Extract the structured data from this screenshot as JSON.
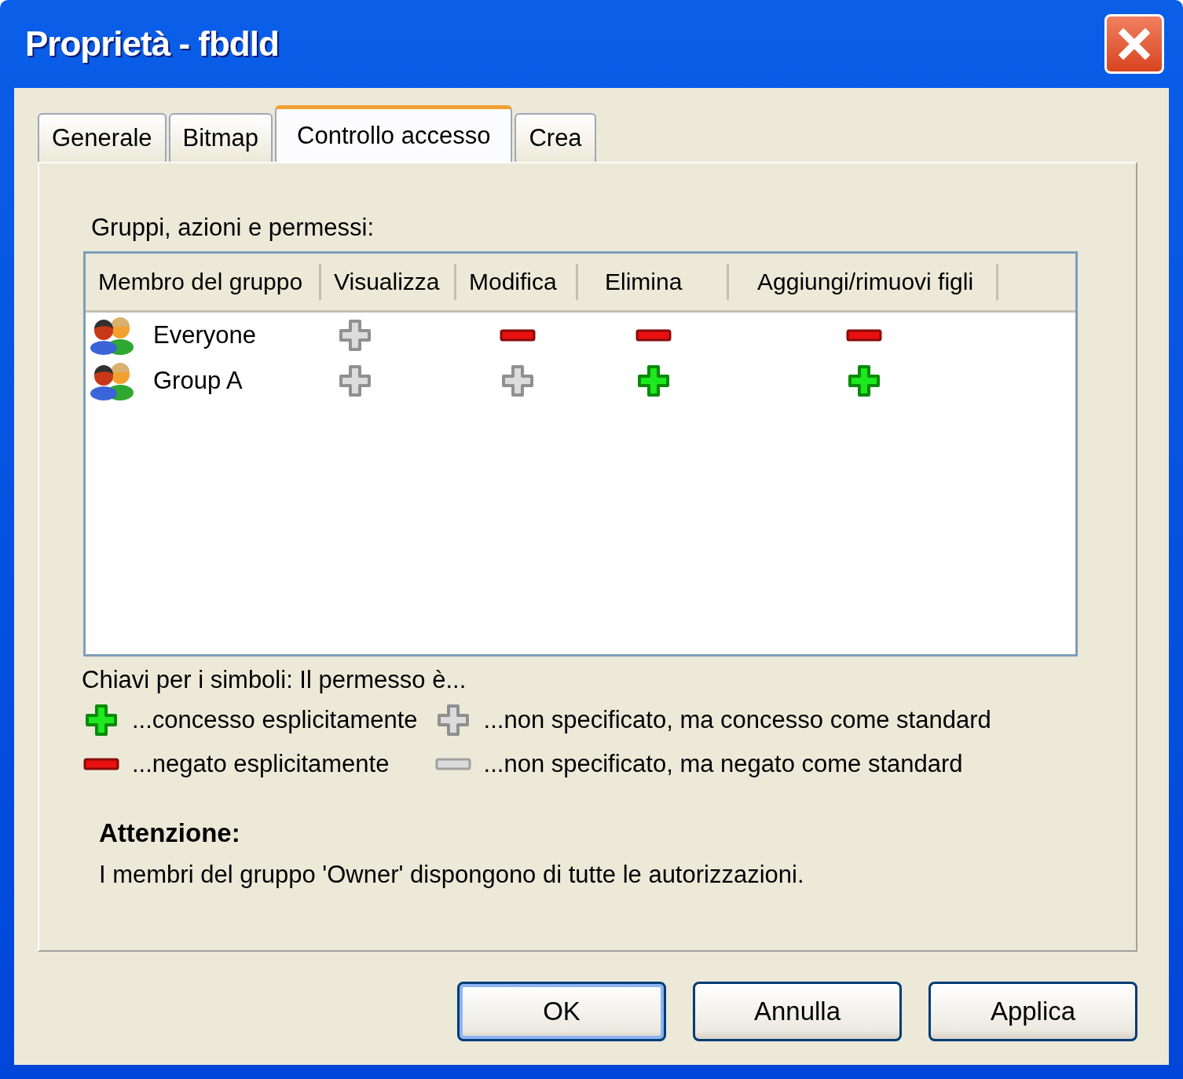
{
  "window": {
    "title": "Proprietà - fbdld"
  },
  "tabs": [
    {
      "label": "Generale",
      "selected": false
    },
    {
      "label": "Bitmap",
      "selected": false
    },
    {
      "label": "Controllo accesso",
      "selected": true
    },
    {
      "label": "Crea",
      "selected": false
    }
  ],
  "table": {
    "caption": "Gruppi, azioni e permessi:",
    "columns": [
      "Membro del gruppo",
      "Visualizza",
      "Modifica",
      "Elimina",
      "Aggiungi/rimuovi figli"
    ],
    "rows": [
      {
        "member": "Everyone",
        "cells": [
          {
            "kind": "default_allow"
          },
          {
            "kind": "deny"
          },
          {
            "kind": "deny"
          },
          {
            "kind": "deny"
          }
        ]
      },
      {
        "member": "Group A",
        "cells": [
          {
            "kind": "default_allow"
          },
          {
            "kind": "default_allow"
          },
          {
            "kind": "allow"
          },
          {
            "kind": "allow"
          }
        ]
      }
    ]
  },
  "legend": {
    "title": "Chiavi per i simboli: Il permesso è...",
    "items": [
      {
        "kind": "allow",
        "text": "...concesso esplicitamente"
      },
      {
        "kind": "default_allow",
        "text": "...non specificato, ma concesso come standard"
      },
      {
        "kind": "deny",
        "text": "...negato esplicitamente"
      },
      {
        "kind": "default_deny",
        "text": "...non specificato, ma negato come standard"
      }
    ]
  },
  "note": {
    "title": "Attenzione:",
    "text": "I membri del gruppo 'Owner' dispongono di tutte le autorizzazioni."
  },
  "buttons": [
    {
      "label": "OK",
      "default": true
    },
    {
      "label": "Annulla",
      "default": false
    },
    {
      "label": "Applica",
      "default": false
    }
  ]
}
